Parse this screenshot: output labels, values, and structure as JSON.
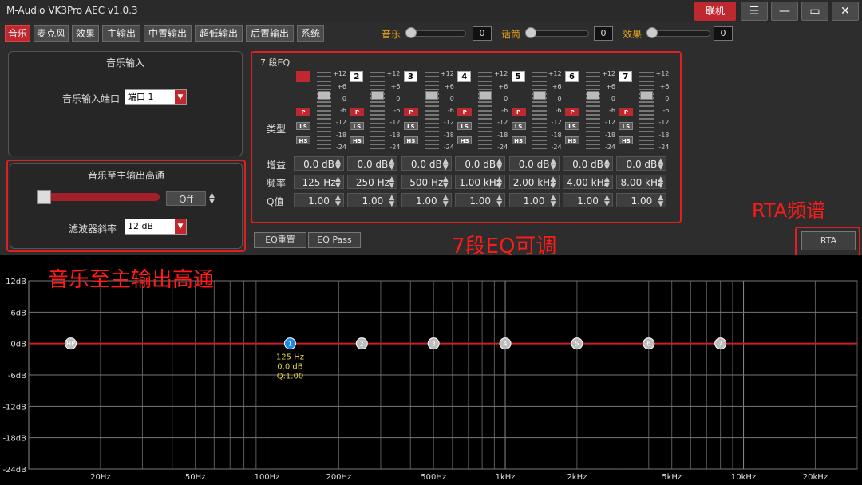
{
  "window": {
    "title": "M-Audio VK3Pro AEC  v1.0.3",
    "connect_label": "联机"
  },
  "tabs": [
    "音乐",
    "麦克风",
    "效果",
    "主输出",
    "中置输出",
    "超低输出",
    "后置输出",
    "系统"
  ],
  "top_sliders": [
    {
      "label": "音乐",
      "value": "0",
      "level": 0
    },
    {
      "label": "话筒",
      "value": "0",
      "level": 0
    },
    {
      "label": "效果",
      "value": "0",
      "level": 0
    }
  ],
  "music_input": {
    "title": "音乐输入",
    "port_label": "音乐输入端口",
    "port_value": "端口 1"
  },
  "highpass": {
    "title": "音乐至主输出高通",
    "state": "Off",
    "level": 0,
    "slope_label": "滤波器斜率",
    "slope_value": "12 dB"
  },
  "eq": {
    "title": "7 段EQ",
    "type_label": "类型",
    "gain_label": "增益",
    "freq_label": "频率",
    "q_label": "Q值",
    "scale": [
      "+12",
      "+6",
      "0",
      "-6",
      "-12",
      "-18",
      "-24"
    ],
    "bands": [
      {
        "num": "1",
        "type_p": "P",
        "type_ls": "LS",
        "type_hs": "HS",
        "gain": "0.0 dB",
        "freq": "125 Hz",
        "q": "1.00"
      },
      {
        "num": "2",
        "type_p": "P",
        "type_ls": "LS",
        "type_hs": "HS",
        "gain": "0.0 dB",
        "freq": "250 Hz",
        "q": "1.00"
      },
      {
        "num": "3",
        "type_p": "P",
        "type_ls": "LS",
        "type_hs": "HS",
        "gain": "0.0 dB",
        "freq": "500 Hz",
        "q": "1.00"
      },
      {
        "num": "4",
        "type_p": "P",
        "type_ls": "LS",
        "type_hs": "HS",
        "gain": "0.0 dB",
        "freq": "1.00 kHz",
        "q": "1.00"
      },
      {
        "num": "5",
        "type_p": "P",
        "type_ls": "LS",
        "type_hs": "HS",
        "gain": "0.0 dB",
        "freq": "2.00 kHz",
        "q": "1.00"
      },
      {
        "num": "6",
        "type_p": "P",
        "type_ls": "LS",
        "type_hs": "HS",
        "gain": "0.0 dB",
        "freq": "4.00 kHz",
        "q": "1.00"
      },
      {
        "num": "7",
        "type_p": "P",
        "type_ls": "LS",
        "type_hs": "HS",
        "gain": "0.0 dB",
        "freq": "8.00 kHz",
        "q": "1.00"
      }
    ],
    "reset_label": "EQ重置",
    "pass_label": "EQ Pass"
  },
  "rta_label": "RTA",
  "annotations": {
    "rta": "RTA频谱",
    "eq": "7段EQ可调",
    "hp": "音乐至主输出高通"
  },
  "graph": {
    "y_labels": [
      "12dB",
      "6dB",
      "0dB",
      "-6dB",
      "-12dB",
      "-18dB",
      "-24dB"
    ],
    "x_labels": [
      "20Hz",
      "50Hz",
      "100Hz",
      "200Hz",
      "500Hz",
      "1kHz",
      "2kHz",
      "5kHz",
      "10kHz",
      "20kHz"
    ],
    "points": [
      {
        "label": "HP",
        "freq": 15,
        "gain": 0
      },
      {
        "label": "1",
        "freq": 125,
        "gain": 0
      },
      {
        "label": "2",
        "freq": 250,
        "gain": 0
      },
      {
        "label": "3",
        "freq": 500,
        "gain": 0
      },
      {
        "label": "4",
        "freq": 1000,
        "gain": 0
      },
      {
        "label": "5",
        "freq": 2000,
        "gain": 0
      },
      {
        "label": "6",
        "freq": 4000,
        "gain": 0
      },
      {
        "label": "7",
        "freq": 8000,
        "gain": 0
      }
    ],
    "selected_info": [
      "125 Hz",
      "0.0 dB",
      "Q:1.00"
    ],
    "colors": {
      "curve": "#cc1f1f",
      "selected": "#1e88e5",
      "point": "#bdbdbd",
      "info": "#e6d23a"
    }
  }
}
